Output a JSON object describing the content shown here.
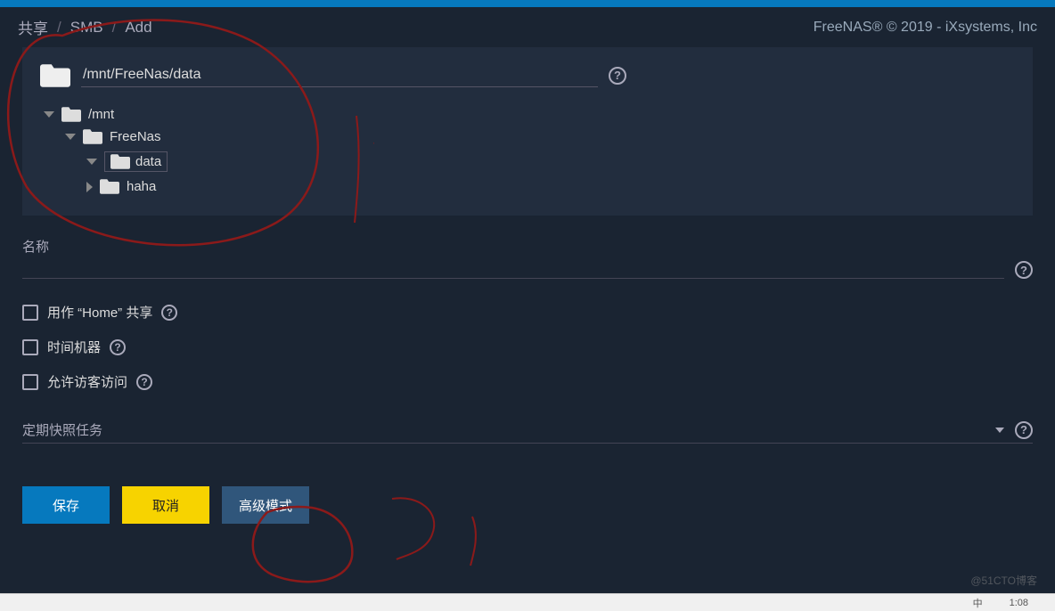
{
  "breadcrumb": {
    "a": "共享",
    "b": "SMB",
    "c": "Add"
  },
  "copyright": "FreeNAS® © 2019 - iXsystems, Inc",
  "path": {
    "value": "/mnt/FreeNas/data"
  },
  "tree": {
    "root": "/mnt",
    "child1": "FreeNas",
    "child2": "data",
    "child3": "haha"
  },
  "form": {
    "name_label": "名称",
    "home_label": "用作 “Home” 共享",
    "time_label": "时间机器",
    "guest_label": "允许访客访问",
    "snapshot_label": "定期快照任务"
  },
  "buttons": {
    "save": "保存",
    "cancel": "取消",
    "advanced": "高级模式"
  },
  "taskbar": {
    "ime": "中",
    "time": "1:08"
  },
  "watermark": "@51CTO博客"
}
